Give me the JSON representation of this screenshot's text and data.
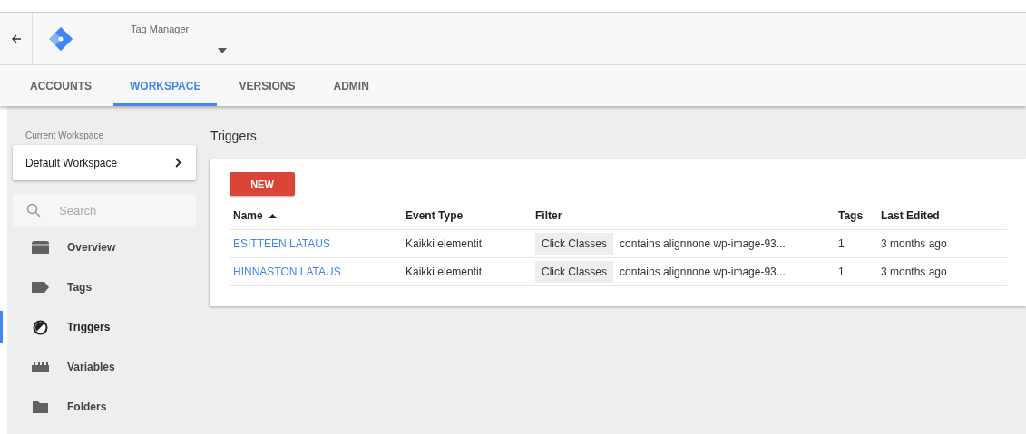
{
  "header": {
    "product": "Tag Manager"
  },
  "tabs": [
    {
      "label": "ACCOUNTS",
      "selected": false
    },
    {
      "label": "WORKSPACE",
      "selected": true
    },
    {
      "label": "VERSIONS",
      "selected": false
    },
    {
      "label": "ADMIN",
      "selected": false
    }
  ],
  "sidebar": {
    "workspace_label": "Current Workspace",
    "workspace": "Default Workspace",
    "search": {
      "placeholder": "Search"
    },
    "items": [
      {
        "kind": "overview",
        "label": "Overview",
        "selected": false
      },
      {
        "kind": "tags",
        "label": "Tags",
        "selected": false
      },
      {
        "kind": "triggers",
        "label": "Triggers",
        "selected": true
      },
      {
        "kind": "variables",
        "label": "Variables",
        "selected": false
      },
      {
        "kind": "folders",
        "label": "Folders",
        "selected": false
      }
    ]
  },
  "main": {
    "title": "Triggers",
    "new_button": "NEW",
    "table": {
      "columns": [
        {
          "label": "Name",
          "sorted": true
        },
        {
          "label": "Event Type",
          "sorted": false
        },
        {
          "label": "Filter",
          "sorted": false
        },
        {
          "label": "Tags",
          "sorted": false
        },
        {
          "label": "Last Edited",
          "sorted": false
        }
      ],
      "rows": [
        {
          "name": "ESITTEEN LATAUS",
          "event_type": "Kaikki elementit",
          "filter_variable": "Click Classes",
          "filter_condition": "contains alignnone wp-image-93...",
          "tags": "1",
          "last_edited": "3 months ago"
        },
        {
          "name": "HINNASTON LATAUS",
          "event_type": "Kaikki elementit",
          "filter_variable": "Click Classes",
          "filter_condition": "contains alignnone wp-image-93...",
          "tags": "1",
          "last_edited": "3 months ago"
        }
      ]
    }
  }
}
